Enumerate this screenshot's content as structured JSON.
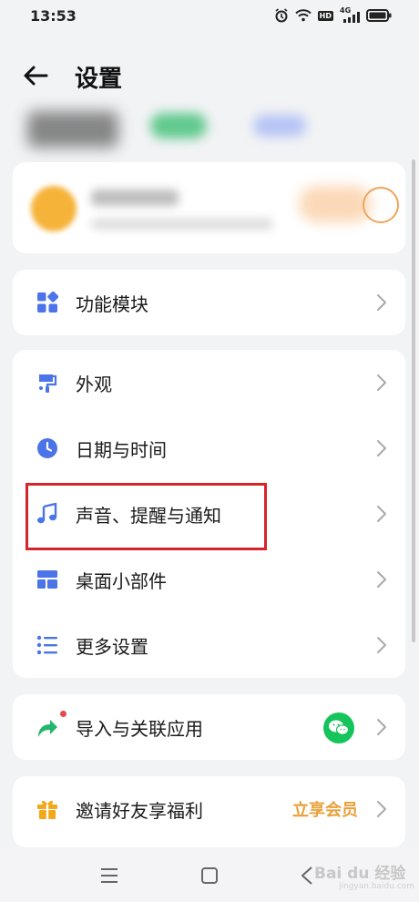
{
  "status_bar": {
    "time": "13:53",
    "hd": "HD",
    "network": "4G"
  },
  "header": {
    "title": "设置"
  },
  "menu": {
    "module": {
      "label": "功能模块"
    },
    "appearance": {
      "label": "外观"
    },
    "datetime": {
      "label": "日期与时间"
    },
    "sound": {
      "label": "声音、提醒与通知"
    },
    "widgets": {
      "label": "桌面小部件"
    },
    "more": {
      "label": "更多设置"
    },
    "import": {
      "label": "导入与关联应用"
    },
    "invite": {
      "label": "邀请好友享福利",
      "action": "立享会员"
    }
  },
  "watermark": {
    "main": "Bai du 经验",
    "sub": "jingyan.baidu.com"
  },
  "colors": {
    "accent": "#4a74e8",
    "highlight": "#d8232a",
    "vip": "#e8a13a",
    "wechat": "#15c45a"
  }
}
